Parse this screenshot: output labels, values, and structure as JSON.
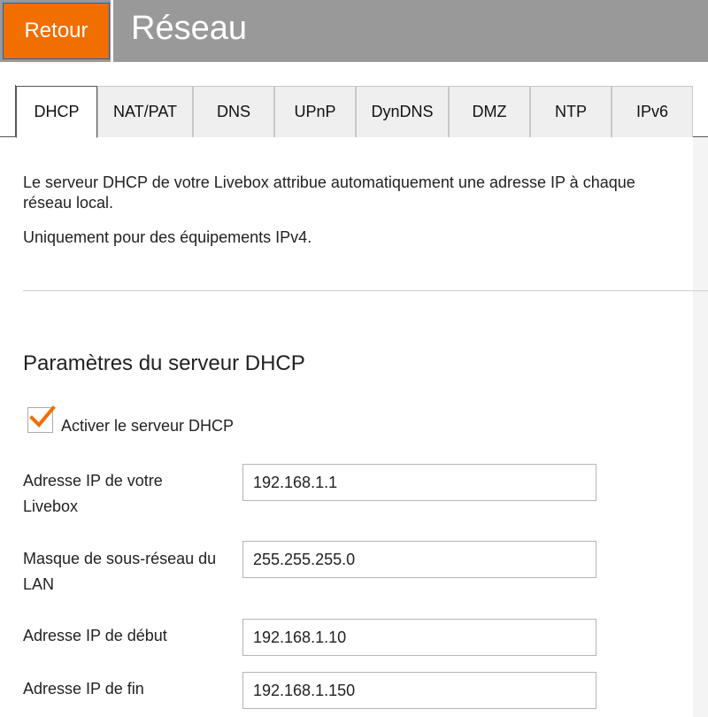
{
  "header": {
    "back_label": "Retour",
    "title": "Réseau"
  },
  "tabs": [
    {
      "label": "DHCP",
      "active": true
    },
    {
      "label": "NAT/PAT",
      "active": false
    },
    {
      "label": "DNS",
      "active": false
    },
    {
      "label": "UPnP",
      "active": false
    },
    {
      "label": "DynDNS",
      "active": false
    },
    {
      "label": "DMZ",
      "active": false
    },
    {
      "label": "NTP",
      "active": false
    },
    {
      "label": "IPv6",
      "active": false
    }
  ],
  "intro": {
    "line1": "Le serveur DHCP de votre Livebox attribue automatiquement une adresse IP à chaque",
    "line2": "réseau local.",
    "line3": "Uniquement pour des équipements IPv4."
  },
  "dhcp": {
    "section_title": "Paramètres du serveur DHCP",
    "enable_label": "Activer le serveur DHCP",
    "enabled": true,
    "fields": [
      {
        "label_line1": "Adresse IP de votre",
        "label_line2": "Livebox",
        "value": "192.168.1.1"
      },
      {
        "label_line1": "Masque de sous-réseau du",
        "label_line2": "LAN",
        "value": "255.255.255.0"
      },
      {
        "label_line1": "Adresse IP de début",
        "label_line2": "",
        "value": "192.168.1.10"
      },
      {
        "label_line1": "Adresse IP de fin",
        "label_line2": "",
        "value": "192.168.1.150"
      }
    ]
  },
  "colors": {
    "accent": "#f16e00",
    "header_bg": "#999999"
  }
}
